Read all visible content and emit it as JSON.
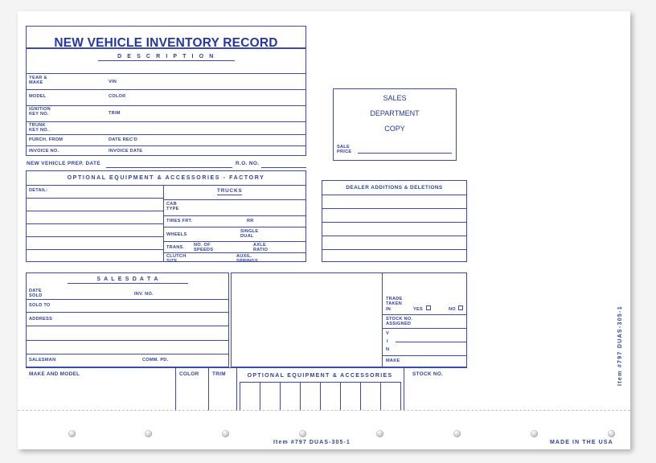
{
  "form": {
    "title": "NEW VEHICLE INVENTORY RECORD",
    "description_heading": "D E S C R I P T I O N",
    "fields": {
      "year_make": "YEAR &\nMAKE",
      "vin": "VIN",
      "model": "MODEL",
      "color": "COLOR",
      "ignition_key_no": "IGNITION\nKEY NO.",
      "trim": "TRIM",
      "trunk_key_no": "TRUNK\nKEY NO.",
      "purch_from": "PURCH. FROM",
      "date_recd": "DATE REC'D",
      "invoice_no": "INVOICE NO.",
      "invoice_date": "INVOICE DATE"
    },
    "prep_line": {
      "prep_date_label": "NEW VEHICLE PREP. DATE",
      "ro_no_label": "R.O. NO."
    },
    "optional_factory": {
      "heading": "OPTIONAL EQUIPMENT & ACCESSORIES - FACTORY",
      "detail_label": "DETAIL:",
      "trucks_heading": "TRUCKS",
      "truck_rows": [
        {
          "left": "CAB\nTYPE",
          "right": ""
        },
        {
          "left": "TIRES FRT.",
          "right": "RR"
        },
        {
          "left": "WHEELS",
          "right": "SINGLE\nDUAL"
        },
        {
          "left": "TRANS.",
          "mid": "NO. OF\nSPEEDS",
          "right": "AXLE\nRATIO"
        },
        {
          "left": "CLUTCH\nSIZE",
          "right": "AUXIL.\nSPRINGS"
        }
      ]
    },
    "sales_dept_copy": {
      "line1": "SALES",
      "line2": "DEPARTMENT",
      "line3": "COPY",
      "sale_price_label": "SALE\nPRICE"
    },
    "dealer_additions": {
      "heading": "DEALER ADDITIONS & DELETIONS",
      "row_count": 5
    },
    "sales_data": {
      "heading": "S A L E S   D A T A",
      "date_sold": "DATE\nSOLD",
      "inv_no": "INV. NO.",
      "sold_to": "SOLD TO",
      "address": "ADDRESS",
      "salesman": "SALESMAN",
      "comm_pd": "COMM. PD."
    },
    "trade": {
      "taken_in_label": "TRADE\nTAKEN\nIN",
      "yes_label": "YES",
      "no_label": "NO",
      "stock_no_assigned": "STOCK NO.\nASSIGNED",
      "vin_v": "V",
      "vin_i": "I",
      "vin_n": "N",
      "make": "MAKE"
    },
    "bottom_strip": {
      "make_and_model": "MAKE AND MODEL",
      "color": "COLOR",
      "trim": "TRIM",
      "optional_heading": "OPTIONAL EQUIPMENT & ACCESSORIES",
      "stock_no": "STOCK NO.",
      "optional_column_count": 8
    },
    "footer": {
      "item_code": "Item #797   DUAS-305-1",
      "made_in": "MADE IN THE USA",
      "side_code": "Item #797   DUAS-305-1"
    },
    "colors": {
      "ink": "#2e3f9f",
      "rule": "#3a4bab",
      "paper": "#ffffff",
      "background": "#f4f4f4",
      "perforation": "#b9b9b9"
    },
    "sprocket_hole_count": 8
  }
}
